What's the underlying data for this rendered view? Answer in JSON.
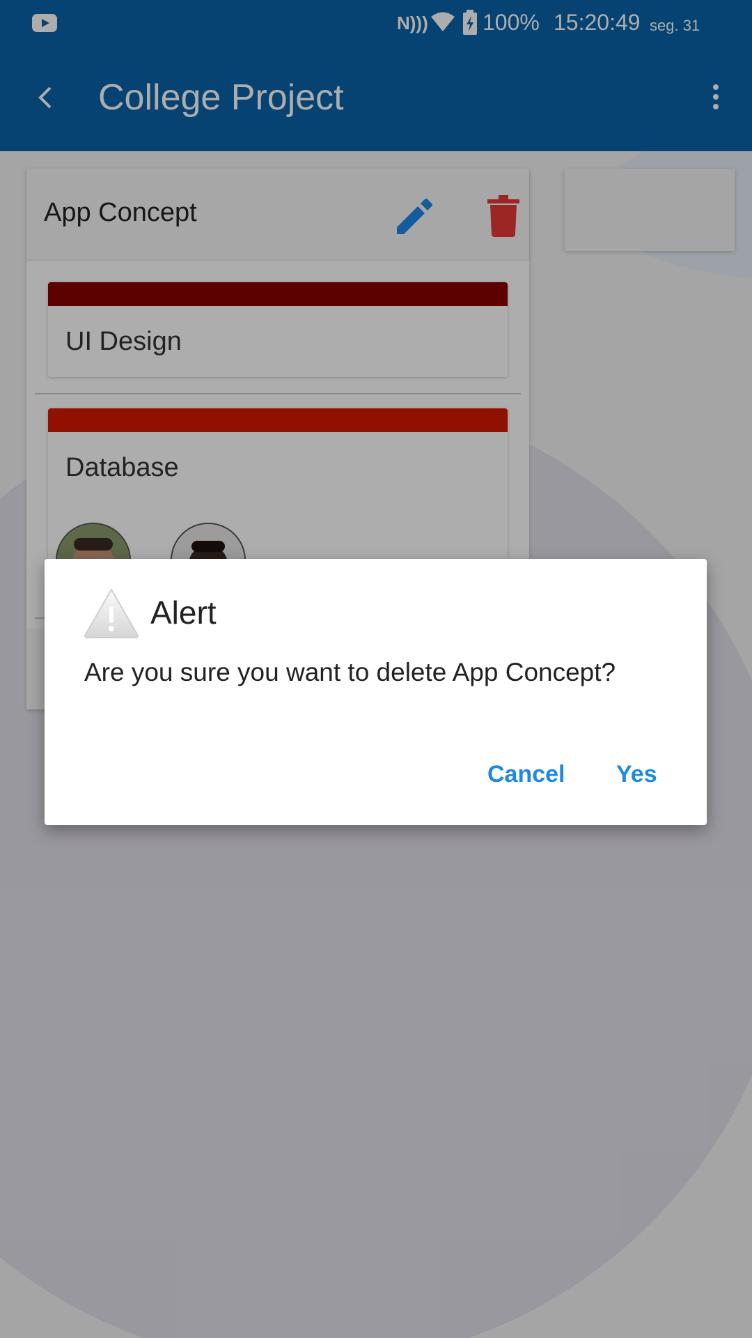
{
  "status_bar": {
    "battery": "100%",
    "time": "15:20:49",
    "date": "seg. 31",
    "icons": [
      "youtube-icon",
      "nfc-icon",
      "wifi-icon",
      "battery-charging-icon"
    ]
  },
  "app_bar": {
    "title": "College Project",
    "icons": [
      "back-icon",
      "more-vert-icon"
    ]
  },
  "board": {
    "lists": [
      {
        "title": "App Concept",
        "tasks": [
          {
            "label": "UI Design",
            "color": "#8a0000"
          },
          {
            "label": "Database",
            "color": "#d41a00",
            "avatars": 2
          }
        ]
      }
    ],
    "action_colors": {
      "edit": "#1e88e5",
      "delete": "#e53935"
    }
  },
  "dialog": {
    "title": "Alert",
    "message": "Are you sure you want to delete App Concept?",
    "cancel_label": "Cancel",
    "confirm_label": "Yes",
    "icon": "warning-icon",
    "accent": "#1e88e5"
  }
}
